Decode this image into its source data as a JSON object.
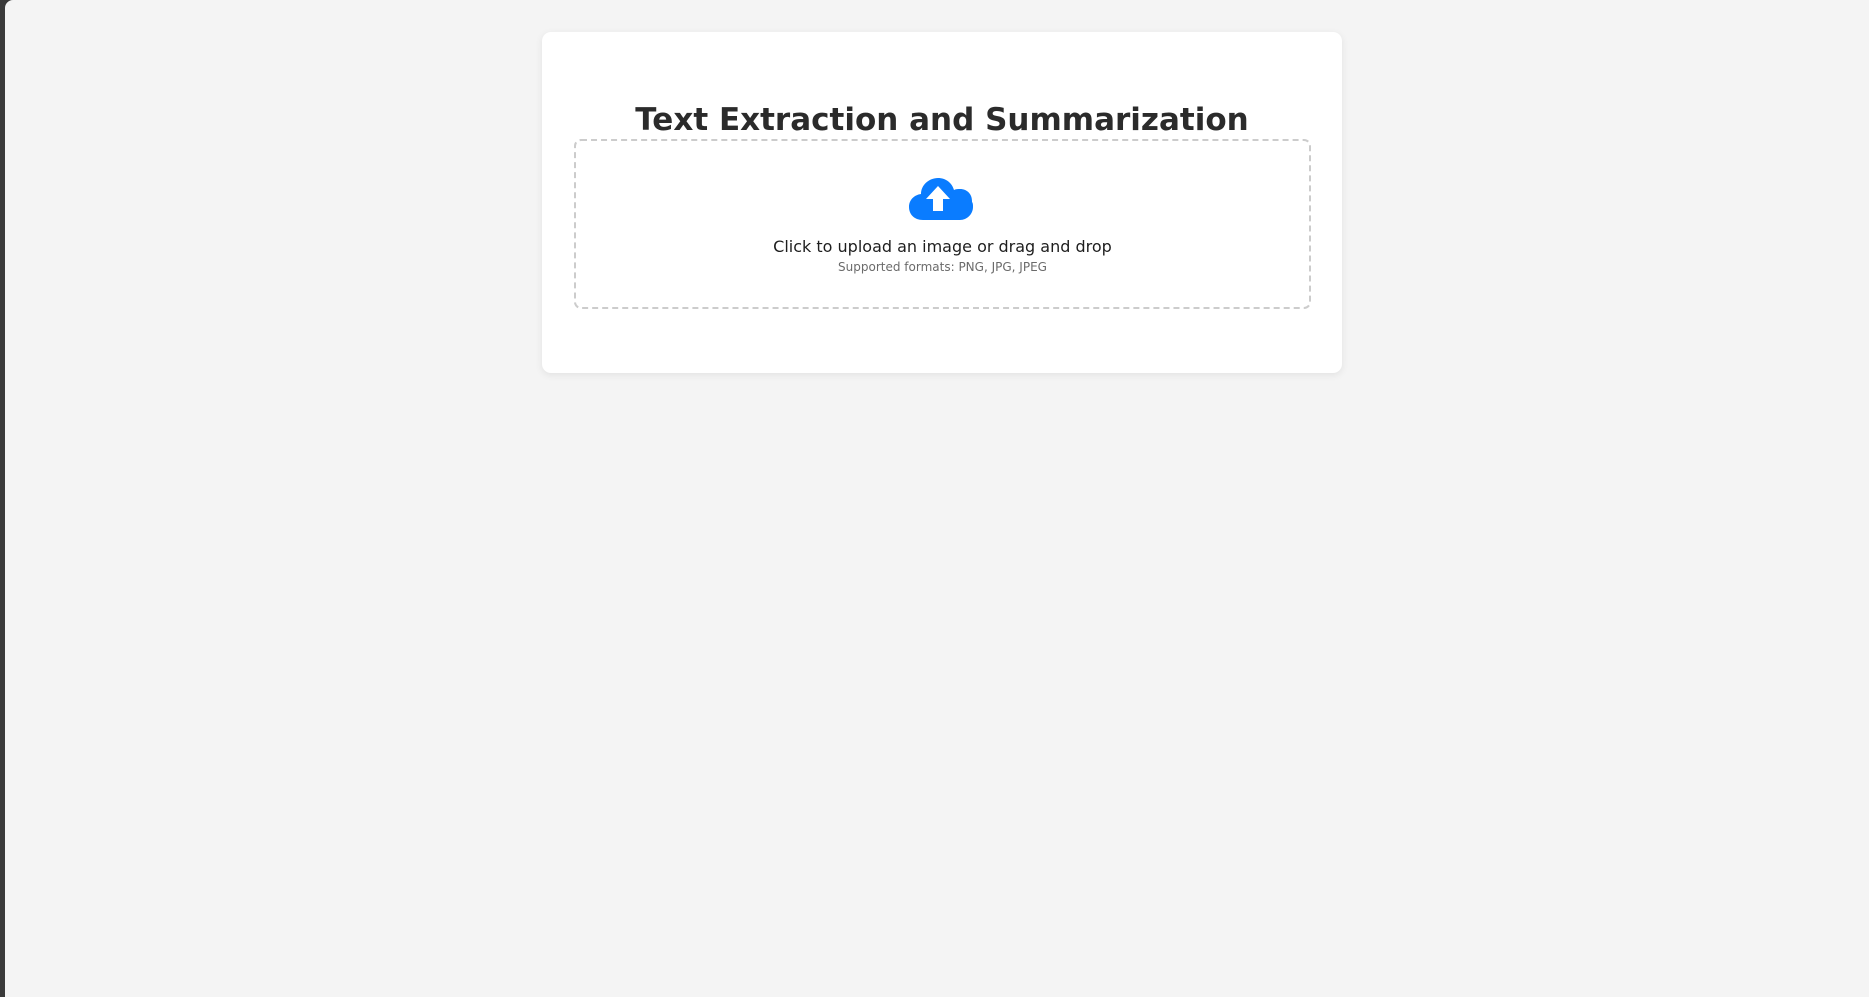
{
  "page": {
    "title": "Text Extraction and Summarization"
  },
  "upload": {
    "icon": "cloud-upload-icon",
    "prompt": "Click to upload an image or drag and drop",
    "formats": "Supported formats: PNG, JPG, JPEG",
    "accent_color": "#0a7cff"
  }
}
